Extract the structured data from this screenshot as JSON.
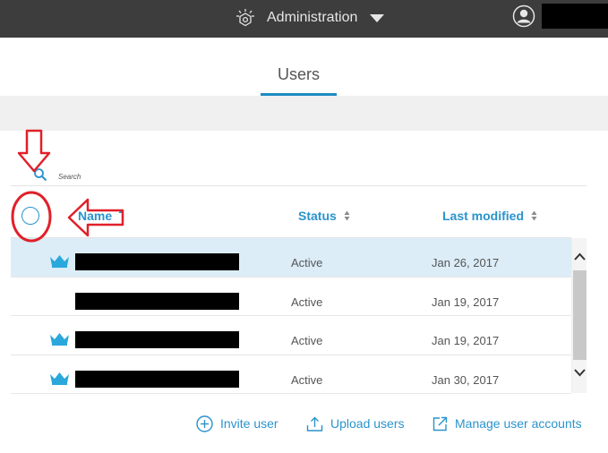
{
  "topbar": {
    "app_title": "Administration",
    "icons": {
      "logo": "ibm-watson-logo-icon",
      "caret": "caret-down-icon",
      "user": "user-avatar-icon"
    }
  },
  "tabs": [
    {
      "label": "Users",
      "active": true
    }
  ],
  "search": {
    "placeholder": "Search"
  },
  "table": {
    "columns": [
      {
        "label": "Name",
        "sort": "ascending"
      },
      {
        "label": "Status",
        "sort": "both"
      },
      {
        "label": "Last modified",
        "sort": "both"
      }
    ],
    "rows": [
      {
        "admin": true,
        "status": "Active",
        "last_modified": "Jan 26, 2017",
        "selected": true
      },
      {
        "admin": false,
        "status": "Active",
        "last_modified": "Jan 19, 2017",
        "selected": false
      },
      {
        "admin": true,
        "status": "Active",
        "last_modified": "Jan 19, 2017",
        "selected": false
      },
      {
        "admin": true,
        "status": "Active",
        "last_modified": "Jan 30, 2017",
        "selected": false
      }
    ]
  },
  "actions": {
    "invite": "Invite user",
    "upload": "Upload users",
    "manage": "Manage user accounts"
  },
  "colors": {
    "accent": "#2a93cc",
    "topbar": "#3d3d3d",
    "selected_row": "#dcedf8",
    "annotation": "#e0202a"
  }
}
